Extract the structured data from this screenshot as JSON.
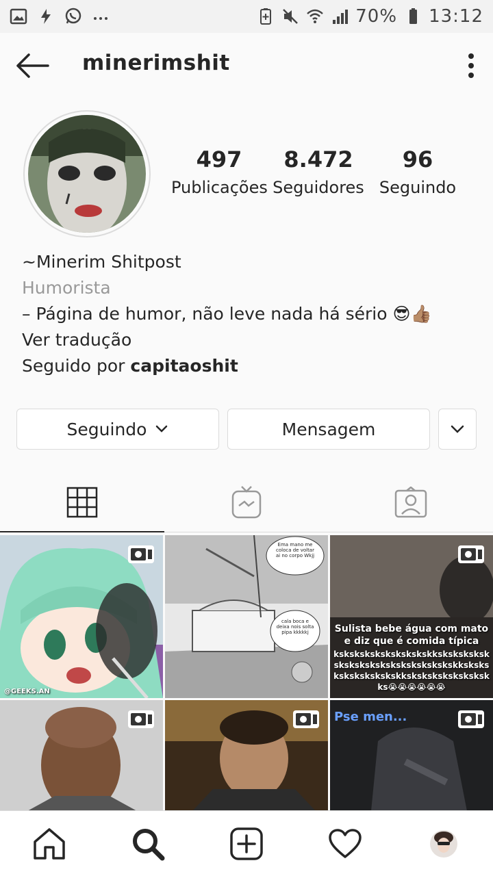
{
  "status_bar": {
    "battery": "70%",
    "time": "13:12",
    "left_icons": [
      "image-icon",
      "bolt-icon",
      "whatsapp-icon",
      "more-dots-icon"
    ],
    "right_icons": [
      "battery-saver-icon",
      "mute-icon",
      "wifi-icon",
      "signal-icon",
      "battery-icon"
    ]
  },
  "header": {
    "username": "minerimshit"
  },
  "profile": {
    "stats": [
      {
        "value": "497",
        "label": "Publicações"
      },
      {
        "value": "8.472",
        "label": "Seguidores"
      },
      {
        "value": "96",
        "label": "Seguindo"
      }
    ],
    "name": "~Minerim Shitpost",
    "category": "Humorista",
    "bio": "– Página de humor, não leve nada há sério 😎👍🏽",
    "translate": "Ver tradução",
    "followed_by_prefix": "Seguido por ",
    "followed_by_user": "capitaoshit"
  },
  "actions": {
    "following": "Seguindo",
    "message": "Mensagem"
  },
  "tabs": [
    "grid-icon",
    "igtv-icon",
    "tagged-icon"
  ],
  "posts": [
    {
      "caption": "@GEEKS.AN",
      "igtv": true
    },
    {
      "bubble_1": "Ema mano me coloca de voltar ai no corpo Wkjj",
      "bubble_2": "cala boca e deixa nois solta pipa kkkkkj",
      "igtv": false
    },
    {
      "caption": "Sulista bebe água com mato e diz que é comida típica",
      "laugh": "kskskskskskskskskskkskskskskskskskskskskskskskskskskskkskskskskskskskskskkskskskskskskskskks😭😭😭😭😭😭",
      "igtv": true
    },
    {
      "igtv": true
    },
    {
      "igtv": true
    },
    {
      "caption": "Pse men...",
      "igtv": true
    }
  ],
  "bottom_nav": [
    "home-icon",
    "search-icon",
    "add-post-icon",
    "activity-icon",
    "profile-avatar"
  ],
  "colors": {
    "text": "#262626",
    "muted": "#999999",
    "border": "#dbdbdb",
    "background": "#fafafa"
  }
}
